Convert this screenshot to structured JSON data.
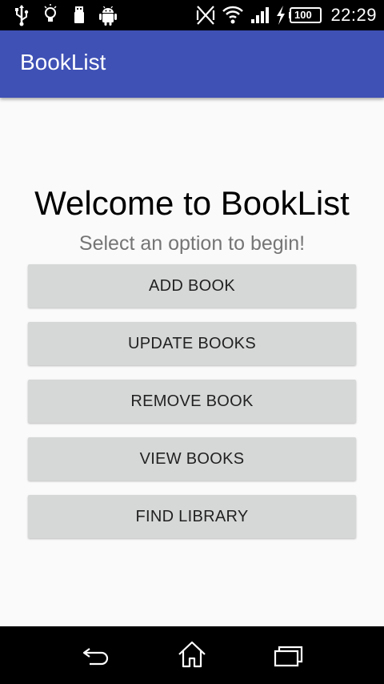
{
  "status_bar": {
    "time": "22:29",
    "battery_level": "100",
    "left_icons": [
      "usb-icon",
      "lightbulb-icon",
      "usb-drive-icon",
      "android-icon"
    ],
    "right_icons": [
      "nfc-off-icon",
      "wifi-icon",
      "signal-icon",
      "charging-icon",
      "battery-icon"
    ]
  },
  "app_bar": {
    "title": "BookList",
    "color": "#3f51b5"
  },
  "main": {
    "heading": "Welcome to BookList",
    "subtitle": "Select an option to begin!",
    "buttons": [
      {
        "label": "ADD BOOK"
      },
      {
        "label": "UPDATE BOOKS"
      },
      {
        "label": "REMOVE BOOK"
      },
      {
        "label": "VIEW BOOKS"
      },
      {
        "label": "FIND LIBRARY"
      }
    ]
  },
  "nav_bar": {
    "icons": [
      "back-icon",
      "home-icon",
      "recents-icon"
    ]
  }
}
